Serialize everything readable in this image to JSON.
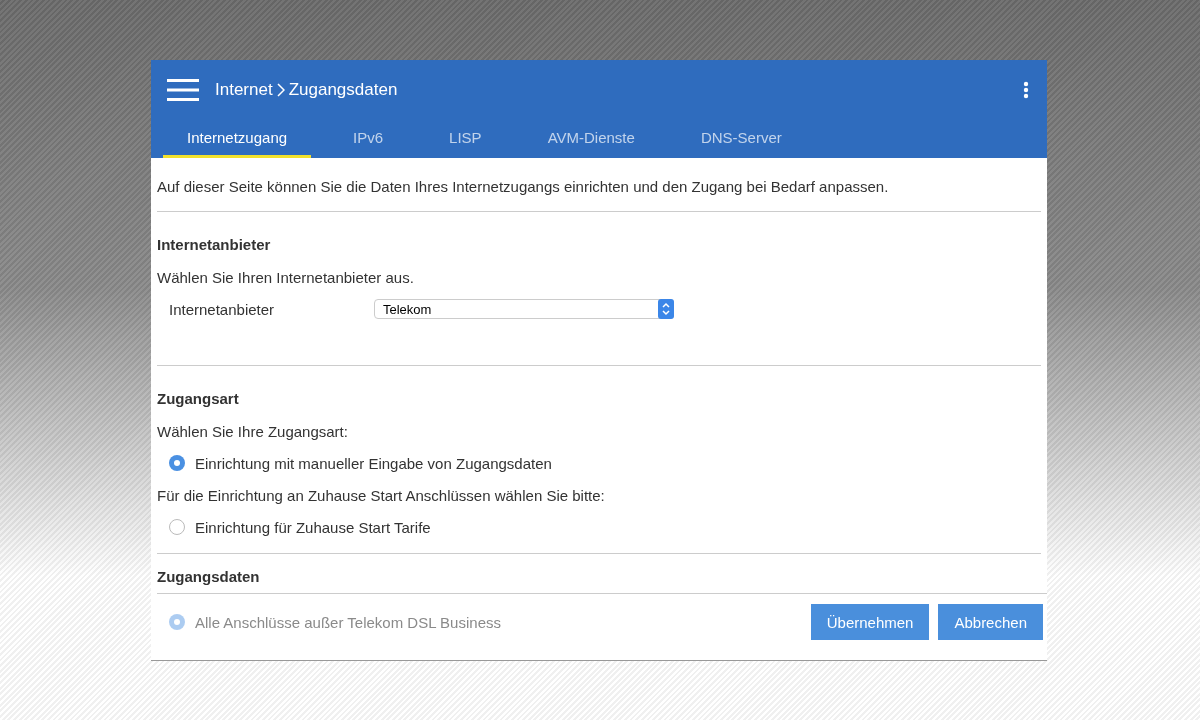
{
  "header": {
    "breadcrumb": [
      "Internet",
      "Zugangsdaten"
    ]
  },
  "tabs": [
    {
      "label": "Internetzugang",
      "selected": true
    },
    {
      "label": "IPv6",
      "selected": false
    },
    {
      "label": "LISP",
      "selected": false
    },
    {
      "label": "AVM-Dienste",
      "selected": false
    },
    {
      "label": "DNS-Server",
      "selected": false
    }
  ],
  "intro": "Auf dieser Seite können Sie die Daten Ihres Internetzugangs einrichten und den Zugang bei Bedarf anpassen.",
  "sections": [
    {
      "title": "Internetanbieter",
      "items": [
        {
          "kind": "text",
          "label": "Wählen Sie Ihren Internetanbieter aus."
        },
        {
          "kind": "select",
          "label": "Internetanbieter",
          "value": "Telekom"
        }
      ]
    },
    {
      "title": "Zugangsart",
      "items": [
        {
          "kind": "text",
          "label": "Wählen Sie Ihre Zugangsart:"
        },
        {
          "kind": "radio",
          "label": "Einrichtung mit manueller Eingabe von Zugangsdaten",
          "selected": true
        },
        {
          "kind": "text",
          "label": "Für die Einrichtung an Zuhause Start Anschlüssen wählen Sie bitte:"
        },
        {
          "kind": "radio",
          "label": "Einrichtung für Zuhause Start Tarife",
          "selected": false
        }
      ]
    },
    {
      "title": "Zugangsdaten",
      "items": [
        {
          "kind": "radio",
          "label": "Alle Anschlüsse außer Telekom DSL Business",
          "selected": true,
          "disabled": true
        }
      ]
    }
  ],
  "buttons": [
    "Übernehmen",
    "Abbrechen"
  ]
}
